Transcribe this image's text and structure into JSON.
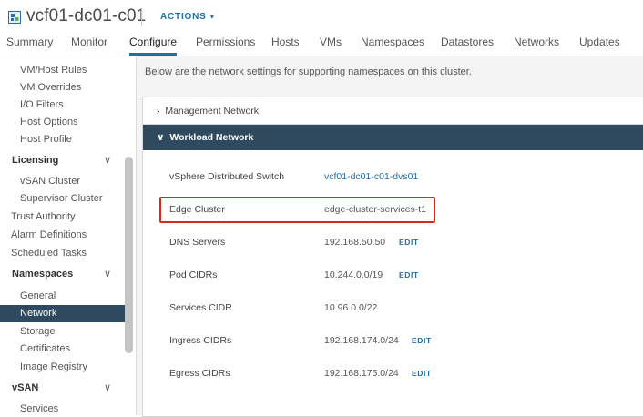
{
  "header": {
    "title": "vcf01-dc01-c01",
    "actions_label": "ACTIONS",
    "caret": "▾",
    "icon": "cluster-icon"
  },
  "tabs": [
    {
      "label": "Summary"
    },
    {
      "label": "Monitor"
    },
    {
      "label": "Configure",
      "active": true
    },
    {
      "label": "Permissions"
    },
    {
      "label": "Hosts"
    },
    {
      "label": "VMs"
    },
    {
      "label": "Namespaces"
    },
    {
      "label": "Datastores"
    },
    {
      "label": "Networks"
    },
    {
      "label": "Updates"
    }
  ],
  "sidebar": {
    "items": [
      {
        "label": "VM/Host Rules"
      },
      {
        "label": "VM Overrides"
      },
      {
        "label": "I/O Filters"
      },
      {
        "label": "Host Options"
      },
      {
        "label": "Host Profile"
      },
      {
        "label": "Licensing",
        "group": true,
        "chevron": "∨"
      },
      {
        "label": "vSAN Cluster"
      },
      {
        "label": "Supervisor Cluster"
      },
      {
        "label": "Trust Authority"
      },
      {
        "label": "Alarm Definitions"
      },
      {
        "label": "Scheduled Tasks"
      },
      {
        "label": "Namespaces",
        "group": true,
        "chevron": "∨"
      },
      {
        "label": "General"
      },
      {
        "label": "Network",
        "active": true
      },
      {
        "label": "Storage"
      },
      {
        "label": "Certificates"
      },
      {
        "label": "Image Registry"
      },
      {
        "label": "vSAN",
        "group": true,
        "chevron": "∨"
      },
      {
        "label": "Services"
      }
    ]
  },
  "main": {
    "intro": "Below are the network settings for supporting namespaces on this cluster.",
    "management_network": {
      "label": "Management Network",
      "chevron": "›"
    },
    "workload_network": {
      "label": "Workload Network",
      "chevron": "∨"
    },
    "edit_label": "EDIT",
    "rows": [
      {
        "key": "vSphere Distributed Switch",
        "value": "vcf01-dc01-c01-dvs01",
        "link": true
      },
      {
        "key": "Edge Cluster",
        "value": "edge-cluster-services-t1",
        "highlighted": true
      },
      {
        "key": "DNS Servers",
        "value": "192.168.50.50",
        "editable": true
      },
      {
        "key": "Pod CIDRs",
        "value": "10.244.0.0/19",
        "editable": true
      },
      {
        "key": "Services CIDR",
        "value": "10.96.0.0/22"
      },
      {
        "key": "Ingress CIDRs",
        "value": "192.168.174.0/24",
        "editable": true
      },
      {
        "key": "Egress CIDRs",
        "value": "192.168.175.0/24",
        "editable": true
      }
    ]
  }
}
